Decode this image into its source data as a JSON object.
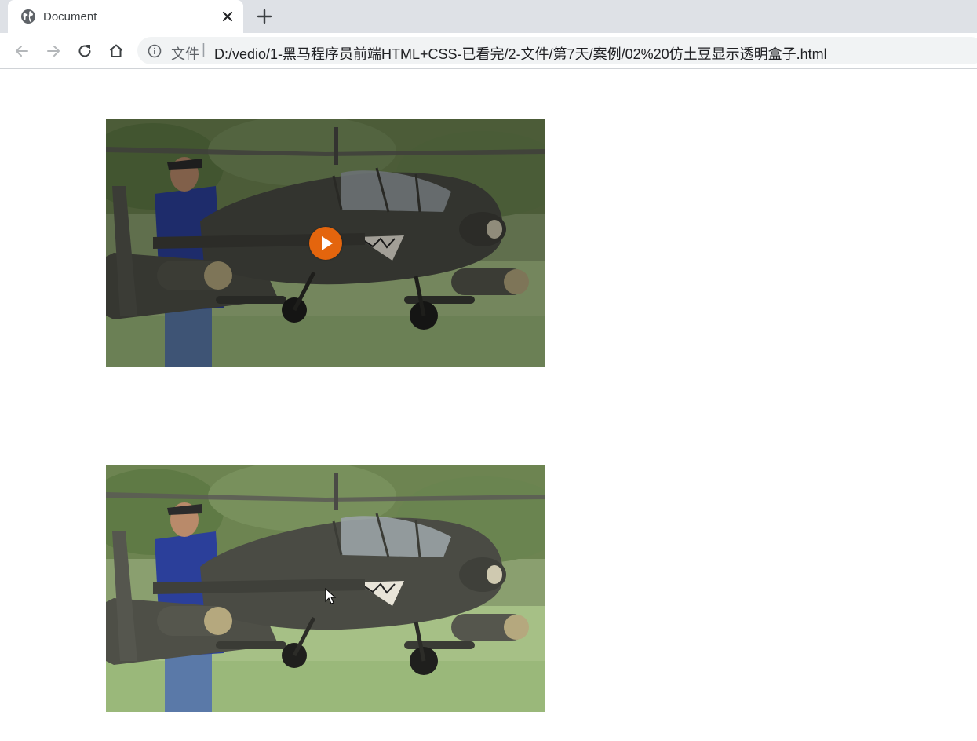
{
  "browser": {
    "tab": {
      "title": "Document",
      "favicon": "globe-icon",
      "close_icon": "close-icon"
    },
    "new_tab_icon": "plus-icon",
    "nav": {
      "back_icon": "back-arrow-icon",
      "forward_icon": "forward-arrow-icon",
      "reload_icon": "reload-icon",
      "home_icon": "home-icon"
    },
    "address_bar": {
      "info_icon": "info-icon",
      "scheme_label": "文件",
      "separator": "|",
      "url": "D:/vedio/1-黑马程序员前端HTML+CSS-已看完/2-文件/第7天/案例/02%20仿土豆显示透明盒子.html"
    }
  },
  "page": {
    "video_boxes": [
      {
        "state": "hover",
        "overlay": "semi-transparent dark mask",
        "play_icon": "play-icon",
        "accent_color": "#e4650d"
      },
      {
        "state": "normal"
      }
    ]
  },
  "colors": {
    "tabbar_bg": "#dee1e6",
    "omnibox_bg": "#f1f3f4",
    "play_button": "#e4650d"
  }
}
